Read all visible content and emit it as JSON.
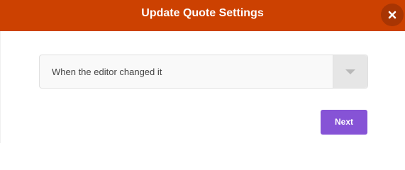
{
  "dialog": {
    "title": "Update Quote Settings",
    "close_icon": "close-icon",
    "select": {
      "value": "When the editor changed it",
      "arrow_icon": "chevron-down-icon"
    },
    "next_label": "Next"
  },
  "colors": {
    "header_bg": "#cc4101",
    "close_bg": "#a83503",
    "next_bg": "#8653d6",
    "select_bg": "#f9f9f9",
    "arrow_area_bg": "#e6e6e6"
  }
}
